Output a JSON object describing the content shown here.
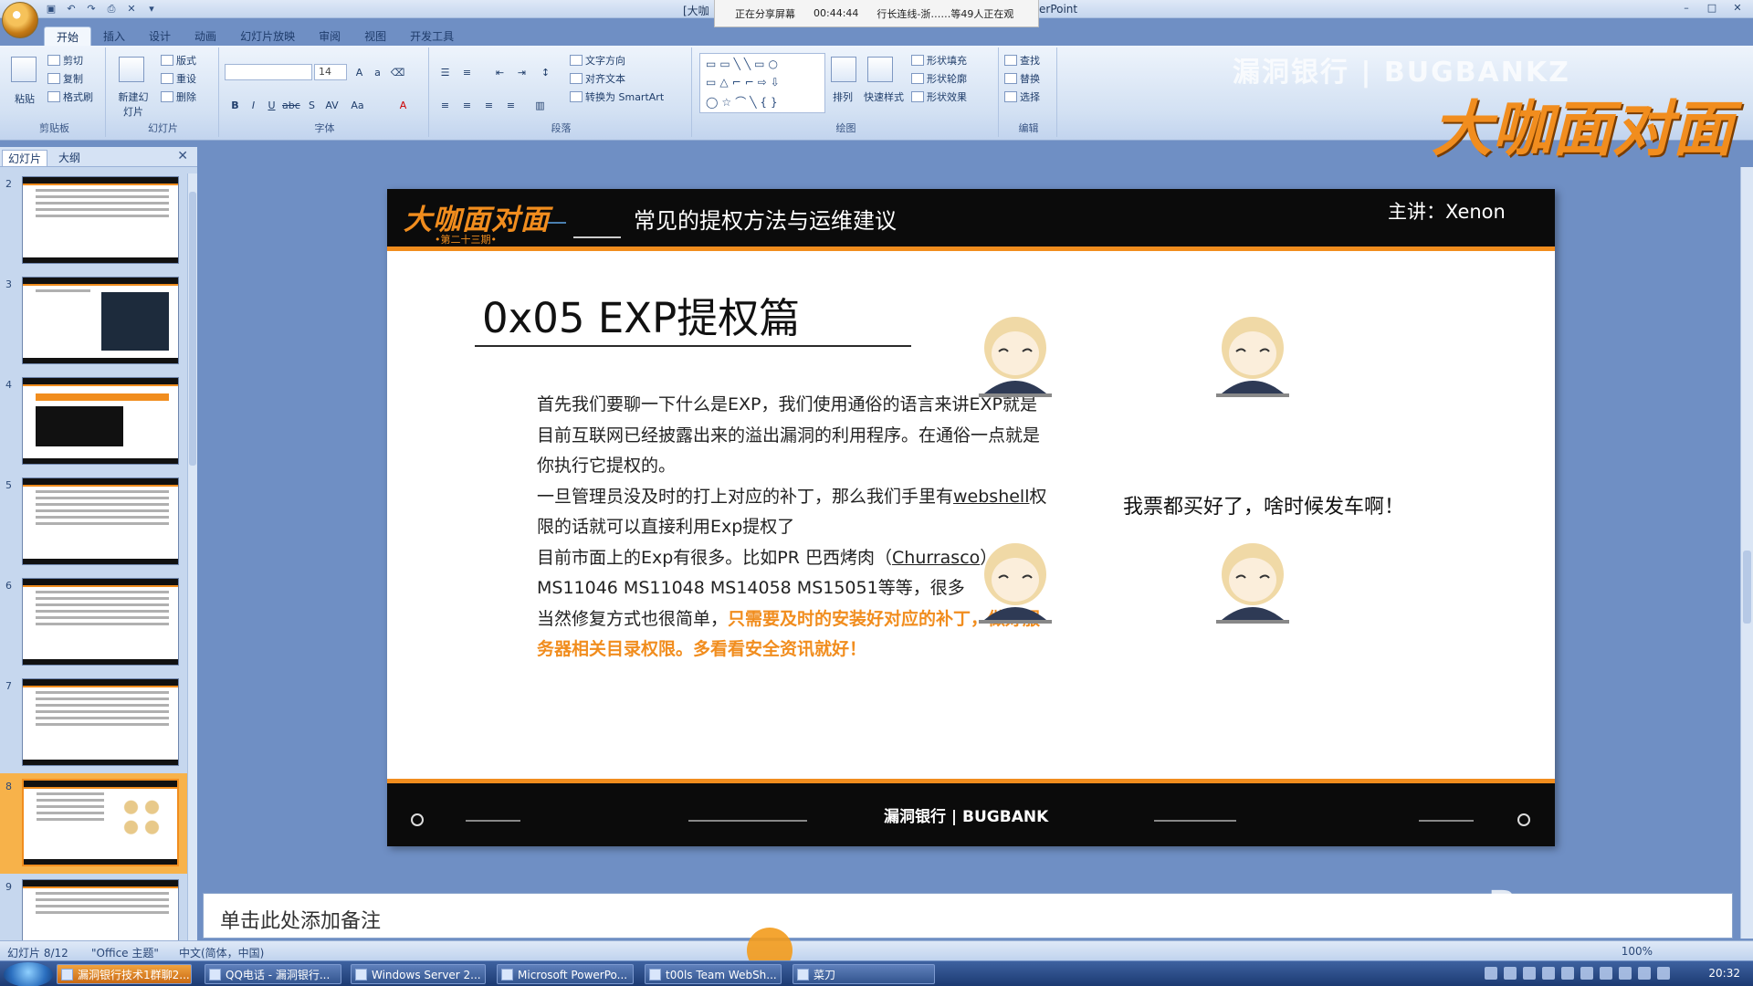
{
  "window": {
    "title_left": "[大咖",
    "title_right": "erPoint"
  },
  "share_bar": {
    "status": "正在分享屏幕",
    "elapsed": "00:44:44",
    "viewers": "行长连线-浙……等49人正在观"
  },
  "ribbon": {
    "tabs": [
      "开始",
      "插入",
      "设计",
      "动画",
      "幻灯片放映",
      "审阅",
      "视图",
      "开发工具"
    ],
    "clipboard": {
      "paste": "粘贴",
      "cut": "剪切",
      "copy": "复制",
      "format_painter": "格式刷",
      "label": "剪贴板"
    },
    "slides": {
      "new_slide": "新建幻灯片",
      "layout": "版式",
      "reset": "重设",
      "delete": "删除",
      "label": "幻灯片"
    },
    "font": {
      "font_name": "",
      "font_size": "14",
      "label": "字体"
    },
    "paragraph": {
      "text_direction": "文字方向",
      "align_text": "对齐文本",
      "convert_smartart": "转换为 SmartArt",
      "label": "段落"
    },
    "drawing": {
      "arrange": "排列",
      "quick_styles": "快速样式",
      "shape_fill": "形状填充",
      "shape_outline": "形状轮廓",
      "shape_effects": "形状效果",
      "label": "绘图"
    },
    "editing": {
      "find": "查找",
      "replace": "替换",
      "select": "选择",
      "label": "编辑"
    }
  },
  "watermark": {
    "banner": "漏洞银行 | BUGBANKZ",
    "logo": "大咖面对面"
  },
  "pane": {
    "tabs": [
      "幻灯片",
      "大纲"
    ],
    "slide_numbers": [
      "2",
      "3",
      "4",
      "5",
      "6",
      "7",
      "8",
      "9"
    ],
    "selected_index": 6
  },
  "slide": {
    "logo": "大咖面对面",
    "logo_sub": "•第二十三期•",
    "header_title": "常见的提权方法与运维建议",
    "speaker": "主讲：Xenon",
    "heading": "0x05  EXP提权篇",
    "para1": "首先我们要聊一下什么是EXP，我们使用通俗的语言来讲EXP就是目前互联网已经披露出来的溢出漏洞的利用程序。在通俗一点就是你执行它提权的。",
    "para2_a": "一旦管理员没及时的打上对应的补丁，那么我们手里有",
    "para2_link": "webshell",
    "para2_b": "权限的话就可以直接利用Exp提权了",
    "para3_a": "目前市面上的Exp有很多。比如PR 巴西烤肉（",
    "para3_link": "Churrasco",
    "para3_b": "）",
    "para4": "MS11046 MS11048  MS14058  MS15051等等，很多",
    "para5_a": "当然修复方式也很简单，",
    "para5_orange": "只需要及时的安装好对应的补丁，做好服务器相关目录权限。多看看安全资讯就好！",
    "meme_caption": "我票都买好了，啥时候发车啊！",
    "footer_logo": "漏洞银行 | BUGBANK"
  },
  "notes": {
    "placeholder": "单击此处添加备注"
  },
  "bug_watermark": {
    "cn": "漏洞银行",
    "en": "BUGBANK"
  },
  "status": {
    "slide_count": "幻灯片 8/12",
    "theme": "\"Office 主题\"",
    "language": "中文(简体，中国)",
    "zoom": "100%"
  },
  "taskbar": {
    "tasks": [
      "漏洞银行技术1群聊2...",
      "QQ电话 - 漏洞银行...",
      "Windows Server 2...",
      "Microsoft PowerPo...",
      "t00ls Team WebSh...",
      "菜刀"
    ],
    "clock": "20:32"
  }
}
